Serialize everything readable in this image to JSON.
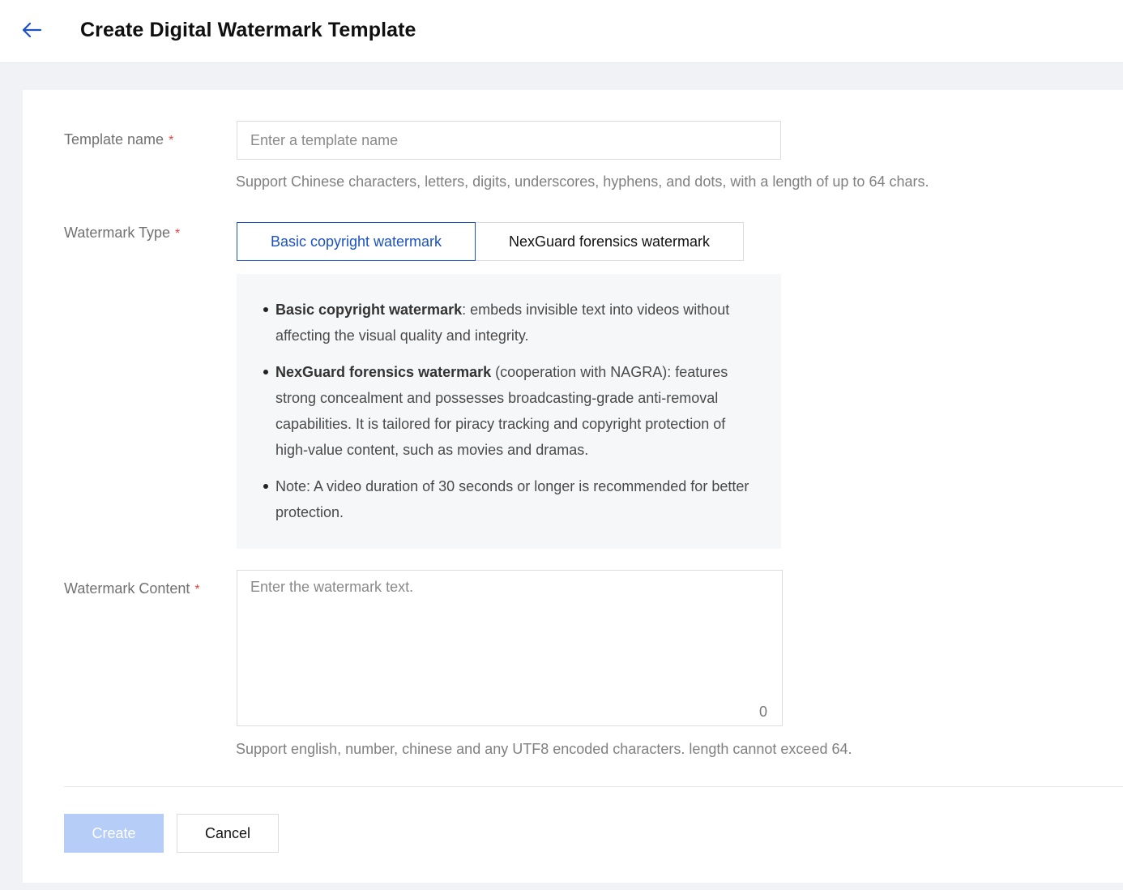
{
  "header": {
    "title": "Create Digital Watermark Template"
  },
  "form": {
    "template_name": {
      "label": "Template name",
      "required_mark": "*",
      "value": "",
      "placeholder": "Enter a template name",
      "hint": "Support Chinese characters, letters, digits, underscores, hyphens, and dots, with a length of up to 64 chars."
    },
    "watermark_type": {
      "label": "Watermark Type",
      "required_mark": "*",
      "options": [
        {
          "label": "Basic copyright watermark",
          "selected": true
        },
        {
          "label": "NexGuard forensics watermark",
          "selected": false
        }
      ],
      "info": [
        {
          "bold": "Basic copyright watermark",
          "text": ": embeds invisible text into videos without affecting the visual quality and integrity."
        },
        {
          "bold": "NexGuard forensics watermark",
          "text": " (cooperation with NAGRA): features strong concealment and possesses broadcasting-grade anti-removal capabilities. It is tailored for piracy tracking and copyright protection of high-value content, such as movies and dramas."
        },
        {
          "bold": "",
          "text": "Note: A video duration of 30 seconds or longer is recommended for better protection."
        }
      ]
    },
    "watermark_content": {
      "label": "Watermark Content",
      "required_mark": "*",
      "value": "",
      "placeholder": "Enter the watermark text.",
      "char_count": "0",
      "hint": "Support english, number, chinese and any UTF8 encoded characters. length cannot exceed 64."
    }
  },
  "actions": {
    "create_label": "Create",
    "cancel_label": "Cancel"
  },
  "colors": {
    "accent": "#1d52c4",
    "required": "#e54545",
    "create_disabled": "#b6cdf7",
    "page_background": "#f1f2f6"
  },
  "icons": {
    "back": "arrow-left-icon"
  }
}
